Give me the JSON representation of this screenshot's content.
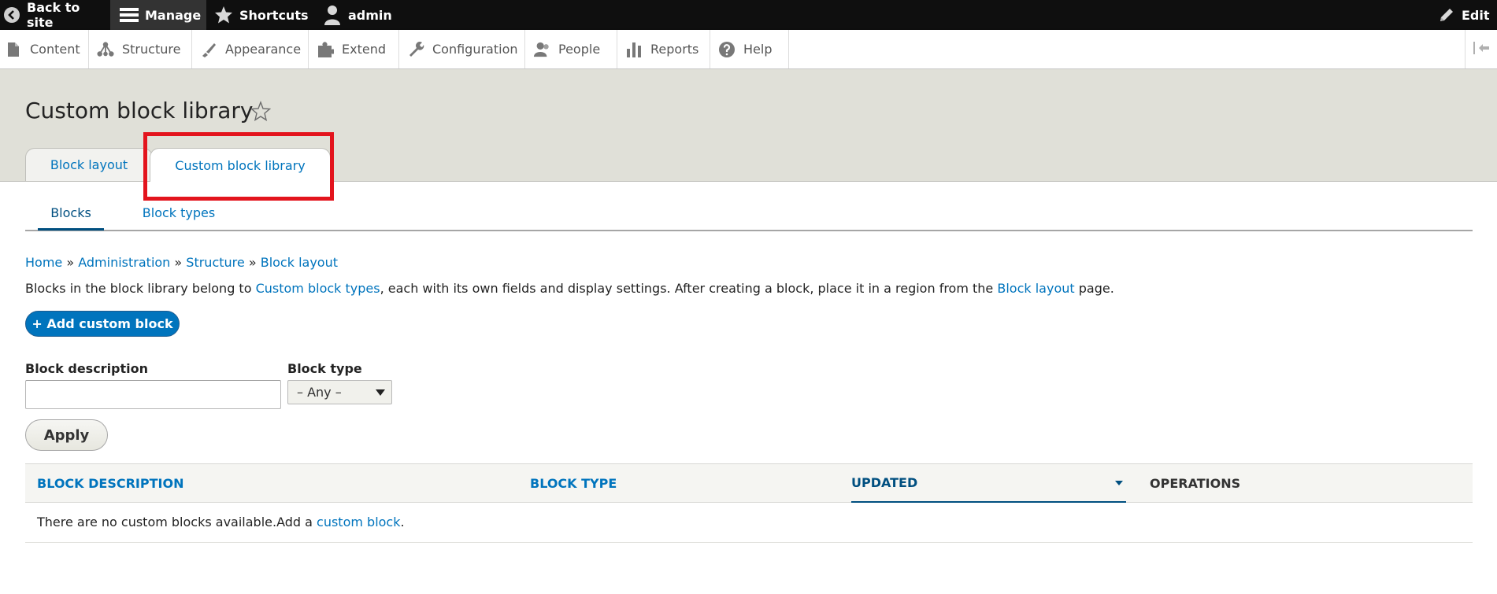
{
  "toolbar": {
    "back_label": "Back to site",
    "manage_label": "Manage",
    "shortcuts_label": "Shortcuts",
    "user_label": "admin",
    "edit_label": "Edit"
  },
  "tray": {
    "items": [
      {
        "label": "Content",
        "icon": "file-icon"
      },
      {
        "label": "Structure",
        "icon": "sitemap-icon"
      },
      {
        "label": "Appearance",
        "icon": "paintbrush-icon"
      },
      {
        "label": "Extend",
        "icon": "puzzle-icon"
      },
      {
        "label": "Configuration",
        "icon": "wrench-icon"
      },
      {
        "label": "People",
        "icon": "people-icon"
      },
      {
        "label": "Reports",
        "icon": "bar-chart-icon"
      },
      {
        "label": "Help",
        "icon": "help-icon"
      }
    ]
  },
  "page": {
    "title": "Custom block library"
  },
  "primary_tabs": [
    {
      "label": "Block layout",
      "active": false
    },
    {
      "label": "Custom block library",
      "active": true
    }
  ],
  "secondary_tabs": [
    {
      "label": "Blocks",
      "active": true
    },
    {
      "label": "Block types",
      "active": false
    }
  ],
  "breadcrumb": {
    "items": [
      "Home",
      "Administration",
      "Structure",
      "Block layout"
    ],
    "separator": "»"
  },
  "description": {
    "part1": "Blocks in the block library belong to ",
    "link1": "Custom block types",
    "part2": ", each with its own fields and display settings. After creating a block, place it in a region from the ",
    "link2": "Block layout",
    "part3": " page."
  },
  "add_button": {
    "label": "+ Add custom block"
  },
  "filters": {
    "description_label": "Block description",
    "description_value": "",
    "type_label": "Block type",
    "type_selected": "– Any –"
  },
  "apply_button": {
    "label": "Apply"
  },
  "table": {
    "headers": [
      "BLOCK DESCRIPTION",
      "BLOCK TYPE",
      "UPDATED",
      "OPERATIONS"
    ],
    "sorted_column": "UPDATED",
    "empty_text": "There are no custom blocks available.Add a ",
    "empty_link": "custom block",
    "empty_suffix": "."
  },
  "colors": {
    "link": "#0074bd",
    "primary_button": "#0074bd",
    "toolbar_bg": "#0f0f0f",
    "header_bg": "#e0e0d8",
    "highlight": "#e3141d"
  }
}
